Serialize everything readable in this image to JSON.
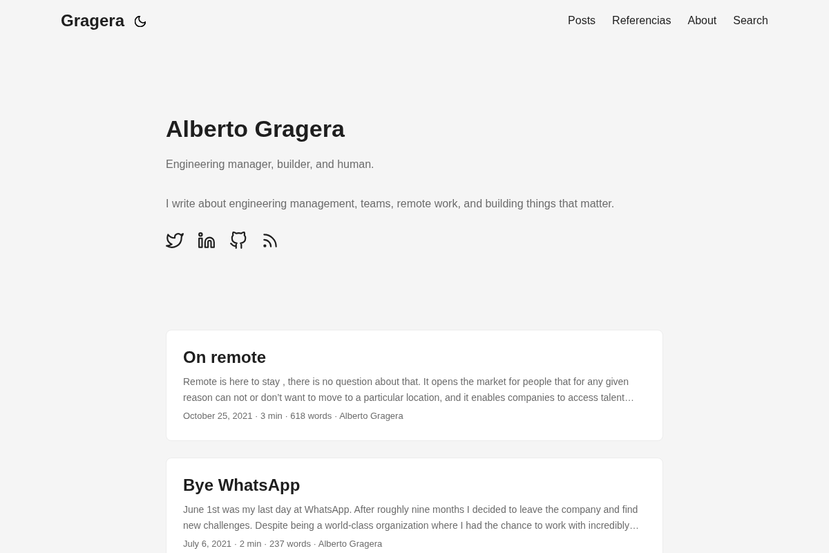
{
  "header": {
    "logo": "Gragera",
    "nav": [
      "Posts",
      "Referencias",
      "About",
      "Search"
    ]
  },
  "hero": {
    "title": "Alberto Gragera",
    "subtitle": "Engineering manager, builder, and human.",
    "intro": "I write about engineering management, teams, remote work, and building things that matter.",
    "social_links": [
      {
        "kind": "twitter"
      },
      {
        "kind": "linkedin"
      },
      {
        "kind": "github"
      },
      {
        "kind": "rss"
      }
    ]
  },
  "posts": [
    {
      "title": "On remote",
      "excerpt": "Remote is here to stay , there is no question about that. It opens the market for people that for any given reason can not or don’t want to move to a particular location, and it enables companies to access talent…",
      "meta": "October 25, 2021 · 3 min · 618 words · Alberto Gragera"
    },
    {
      "title": "Bye WhatsApp",
      "excerpt": "June 1st was my last day at WhatsApp. After roughly nine months I decided to leave the company and find new challenges. Despite being a world-class organization where I had the chance to work with incredibly…",
      "meta": "July 6, 2021 · 2 min · 237 words · Alberto Gragera"
    }
  ]
}
